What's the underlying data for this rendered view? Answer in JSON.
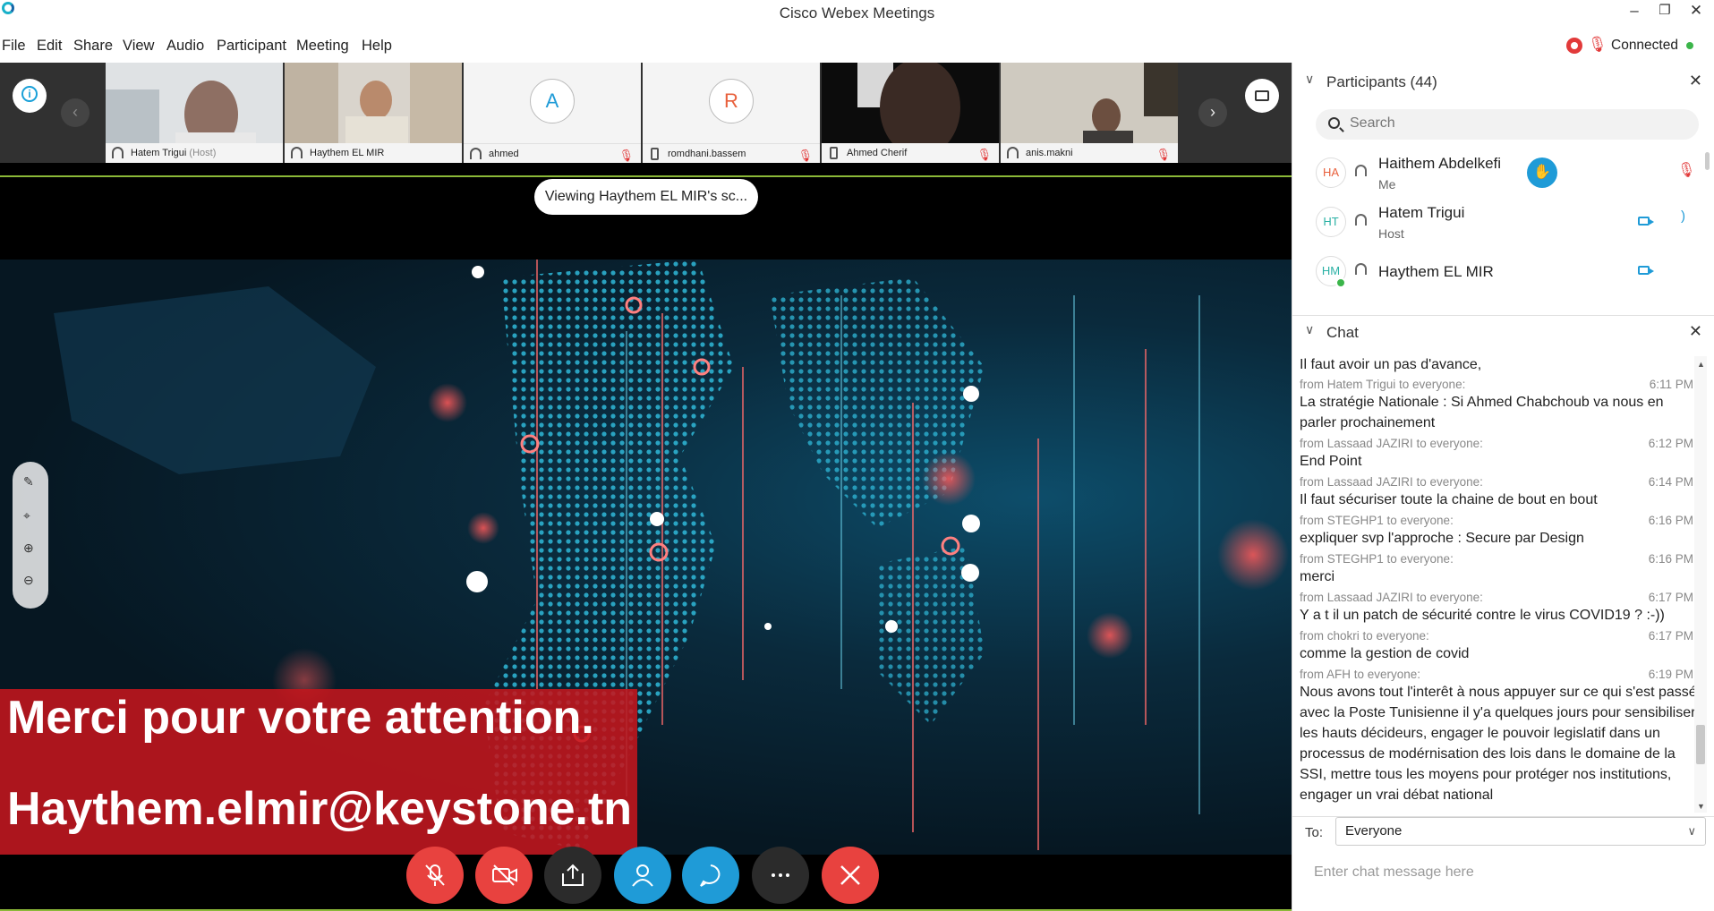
{
  "window": {
    "title": "Cisco Webex Meetings"
  },
  "menu": [
    "File",
    "Edit",
    "Share",
    "View",
    "Audio",
    "Participant",
    "Meeting",
    "Help"
  ],
  "status": {
    "connection": "Connected"
  },
  "filmstrip": {
    "tiles": [
      {
        "name": "Hatem Trigui",
        "role": "(Host)"
      },
      {
        "name": "Haythem EL MIR",
        "role": ""
      },
      {
        "name": "ahmed",
        "initial": "A",
        "initial_color": "#1f9bd7"
      },
      {
        "name": "romdhani.bassem",
        "initial": "R",
        "initial_color": "#e8603c"
      },
      {
        "name": "Ahmed Cherif",
        "role": ""
      },
      {
        "name": "anis.makni",
        "role": ""
      }
    ]
  },
  "viewing": "Viewing Haythem EL MIR's sc...",
  "slide": {
    "line1": "Merci pour votre attention.",
    "line2": "Haythem.elmir@keystone.tn"
  },
  "participants": {
    "header": "Participants (44)",
    "search_placeholder": "Search",
    "list": [
      {
        "initials": "HA",
        "name": "Haithem Abdelkefi",
        "role": "Me",
        "color": "#e8603c"
      },
      {
        "initials": "HT",
        "name": "Hatem Trigui",
        "role": "Host",
        "color": "#2bb1a5"
      },
      {
        "initials": "HM",
        "name": "Haythem EL MIR",
        "role": "",
        "color": "#2bb1a5"
      }
    ]
  },
  "chat": {
    "header": "Chat",
    "messages": [
      {
        "meta": "",
        "time": "",
        "text": "Il faut avoir un pas d'avance,"
      },
      {
        "meta": "from Hatem Trigui to everyone:",
        "time": "6:11 PM",
        "text": "La stratégie Nationale : Si Ahmed Chabchoub va nous en parler prochainement"
      },
      {
        "meta": "from Lassaad JAZIRI to everyone:",
        "time": "6:12 PM",
        "text": "End Point"
      },
      {
        "meta": "from Lassaad JAZIRI to everyone:",
        "time": "6:14 PM",
        "text": "Il faut sécuriser toute la chaine de bout en bout"
      },
      {
        "meta": "from STEGHP1 to everyone:",
        "time": "6:16 PM",
        "text": "expliquer svp l'approche :  Secure par Design"
      },
      {
        "meta": "from STEGHP1 to everyone:",
        "time": "6:16 PM",
        "text": "merci"
      },
      {
        "meta": "from Lassaad JAZIRI to everyone:",
        "time": "6:17 PM",
        "text": "Y a t il un patch de sécurité contre le virus COVID19 ? :-))"
      },
      {
        "meta": "from chokri to everyone:",
        "time": "6:17 PM",
        "text": "comme  la gestion de covid"
      },
      {
        "meta": "from AFH to everyone:",
        "time": "6:19 PM",
        "text": "Nous avons tout l'interêt à nous appuyer sur ce qui s'est passé avec la Poste Tunisienne il y'a quelques jours pour sensibiliser les hauts décideurs, engager le pouvoir legislatif dans un processus de modérnisation des lois dans le domaine de la SSI, mettre tous les moyens pour protéger nos institutions, engager un vrai débat national"
      }
    ],
    "to_label": "To:",
    "to_value": "Everyone",
    "input_placeholder": "Enter chat message here"
  },
  "colors": {
    "mute_red": "#e23a3a",
    "share_blue": "#1f9bd7",
    "end_red": "#e8423f",
    "dark_btn": "#2b2b2b"
  }
}
